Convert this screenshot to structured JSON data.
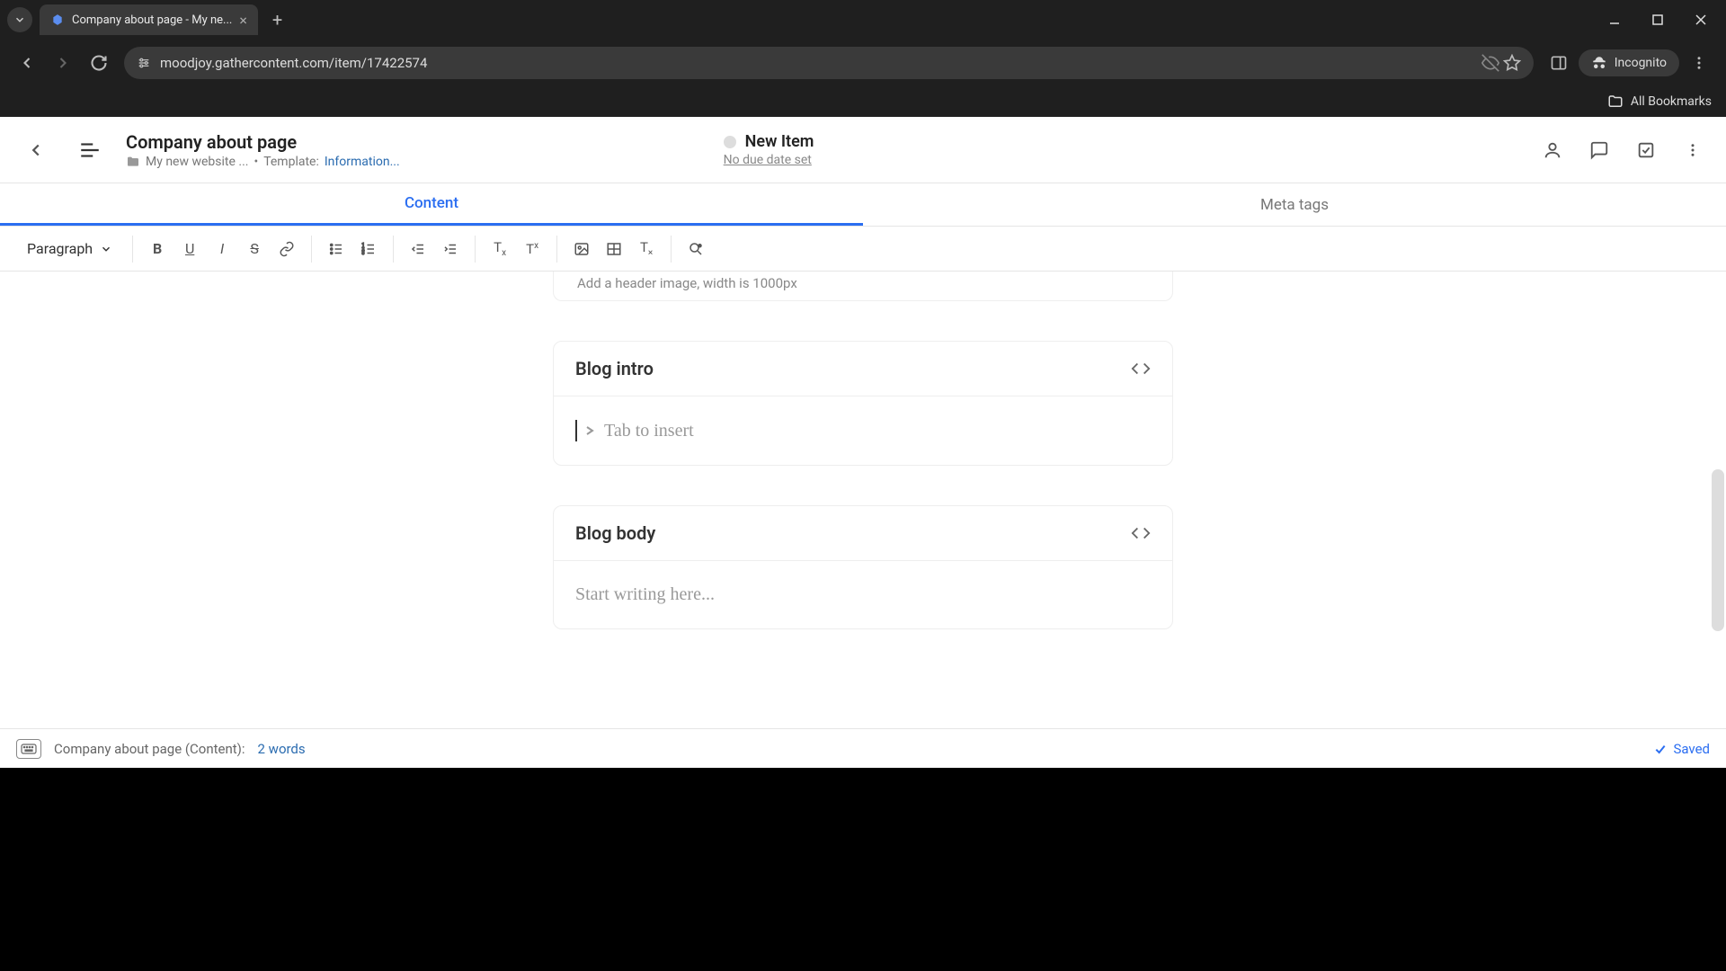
{
  "browser": {
    "tab_title": "Company about page - My ne...",
    "url": "moodjoy.gathercontent.com/item/17422574",
    "incognito_label": "Incognito",
    "all_bookmarks": "All Bookmarks"
  },
  "header": {
    "title": "Company about page",
    "breadcrumb_project": "My new website ...",
    "breadcrumb_sep": "•",
    "template_label": "Template:",
    "template_value": "Information...",
    "status_label": "New Item",
    "due_date": "No due date set"
  },
  "tabs": {
    "content": "Content",
    "meta": "Meta tags"
  },
  "toolbar": {
    "format": "Paragraph"
  },
  "fields": {
    "header_hint": "Add a header image, width is 1000px",
    "intro_title": "Blog intro",
    "intro_placeholder": "Tab to insert",
    "body_title": "Blog body",
    "body_placeholder": "Start writing here..."
  },
  "statusbar": {
    "context": "Company about page (Content):",
    "word_count": "2 words",
    "saved": "Saved"
  }
}
